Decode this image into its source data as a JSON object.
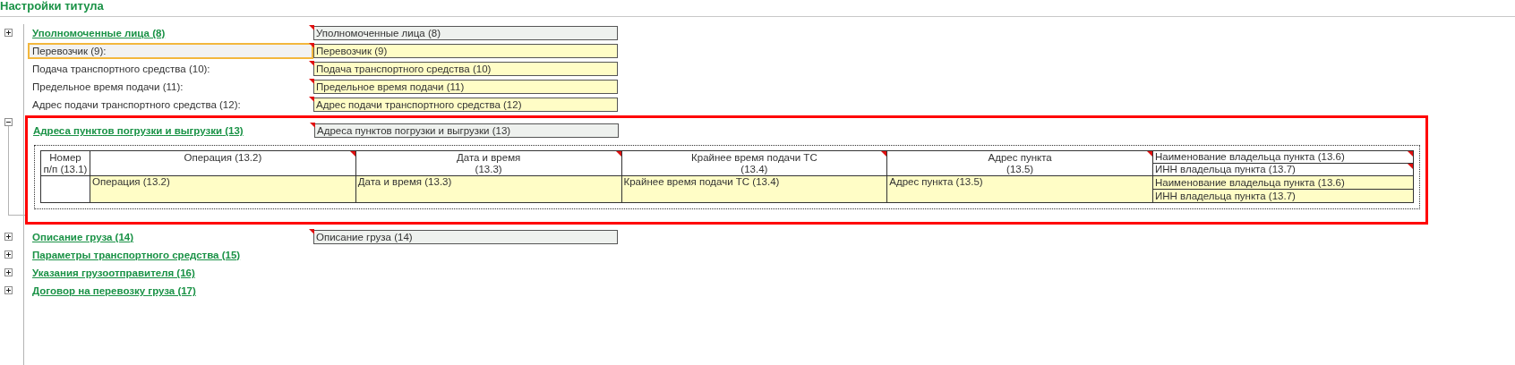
{
  "title": "Настройки титула",
  "items": [
    {
      "kind": "group",
      "label": "Уполномоченные лица (8)",
      "expanded": false,
      "highlighted": false,
      "value": "Уполномоченные лица (8)"
    },
    {
      "kind": "field",
      "label": "Перевозчик (9):",
      "selected": true,
      "value": "Перевозчик (9)"
    },
    {
      "kind": "field",
      "label": "Подача транспортного средства (10):",
      "selected": false,
      "value": "Подача транспортного средства (10)"
    },
    {
      "kind": "field",
      "label": "Предельное время подачи (11):",
      "selected": false,
      "value": "Предельное время подачи (11)"
    },
    {
      "kind": "field",
      "label": "Адрес подачи транспортного средства (12):",
      "selected": false,
      "value": "Адрес подачи транспортного средства (12)"
    },
    {
      "kind": "group",
      "label": "Адреса пунктов погрузки и выгрузки (13)",
      "expanded": true,
      "highlighted": true,
      "value": "Адреса пунктов погрузки и выгрузки (13)",
      "table": {
        "columns": [
          {
            "kind": "single",
            "header": "Номер\nп/п (13.1)"
          },
          {
            "kind": "single",
            "header": "Операция (13.2)",
            "cell": "Операция (13.2)"
          },
          {
            "kind": "single",
            "header": "Дата и время\n(13.3)",
            "cell": "Дата и время (13.3)"
          },
          {
            "kind": "single",
            "header": "Крайнее время подачи ТС\n(13.4)",
            "cell": "Крайнее время подачи ТС (13.4)"
          },
          {
            "kind": "single",
            "header": "Адрес пункта\n(13.5)",
            "cell": "Адрес пункта (13.5)"
          },
          {
            "kind": "stacked",
            "headers": [
              "Наименование владельца пункта (13.6)",
              "ИНН владельца пункта (13.7)"
            ],
            "cells": [
              "Наименование владельца пункта (13.6)",
              "ИНН владельца пункта (13.7)"
            ]
          }
        ]
      }
    },
    {
      "kind": "group",
      "label": "Описание груза (14)",
      "expanded": false,
      "highlighted": false,
      "value": "Описание груза (14)"
    },
    {
      "kind": "group",
      "label": "Параметры транспортного средства (15)",
      "expanded": false,
      "highlighted": false
    },
    {
      "kind": "group",
      "label": "Указания грузоотправителя (16)",
      "expanded": false,
      "highlighted": false
    },
    {
      "kind": "group",
      "label": "Договор на перевозку груза (17)",
      "expanded": false,
      "highlighted": false
    }
  ]
}
